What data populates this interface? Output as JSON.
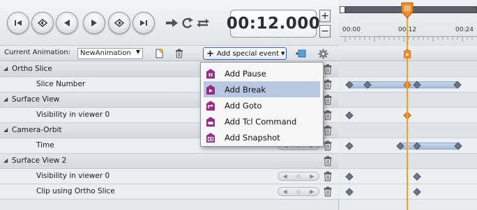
{
  "transport": {
    "buttons": [
      "go-to-start-icon",
      "previous-keyframe-icon",
      "play-backward-icon",
      "play-forward-icon",
      "next-keyframe-icon",
      "go-to-end-icon"
    ],
    "modes": [
      "play-once-icon",
      "loop-icon",
      "swing-icon"
    ],
    "time": "00:12.000",
    "increment": "+",
    "decrement": "−"
  },
  "toolbar": {
    "current_animation_label": "Current Animation:",
    "current_animation_value": "NewAnimation",
    "add_special_event_label": "Add special event"
  },
  "menu": {
    "items": [
      {
        "label": "Add Pause",
        "icon": "pause-event-icon",
        "highlighted": false
      },
      {
        "label": "Add Break",
        "icon": "break-event-icon",
        "highlighted": true
      },
      {
        "label": "Add Goto",
        "icon": "goto-event-icon",
        "highlighted": false
      },
      {
        "label": "Add Tcl Command",
        "icon": "tcl-event-icon",
        "highlighted": false
      },
      {
        "label": "Add Snapshot",
        "icon": "snapshot-event-icon",
        "highlighted": false
      }
    ]
  },
  "tree": {
    "rows": [
      {
        "label": "Ortho Slice",
        "type": "group"
      },
      {
        "label": "Slice Number",
        "type": "child"
      },
      {
        "label": "Surface View",
        "type": "group"
      },
      {
        "label": "Visibility in viewer 0",
        "type": "child"
      },
      {
        "label": "Camera-Orbit",
        "type": "group"
      },
      {
        "label": "Time",
        "type": "child"
      },
      {
        "label": "Surface View 2",
        "type": "group"
      },
      {
        "label": "Visibility in viewer 0",
        "type": "child"
      },
      {
        "label": "Clip using Ortho Slice",
        "type": "child"
      }
    ]
  },
  "timeline": {
    "ruler_labels": [
      "00:00",
      "00:12",
      "00:24"
    ],
    "accent_color": "#f5a020"
  }
}
